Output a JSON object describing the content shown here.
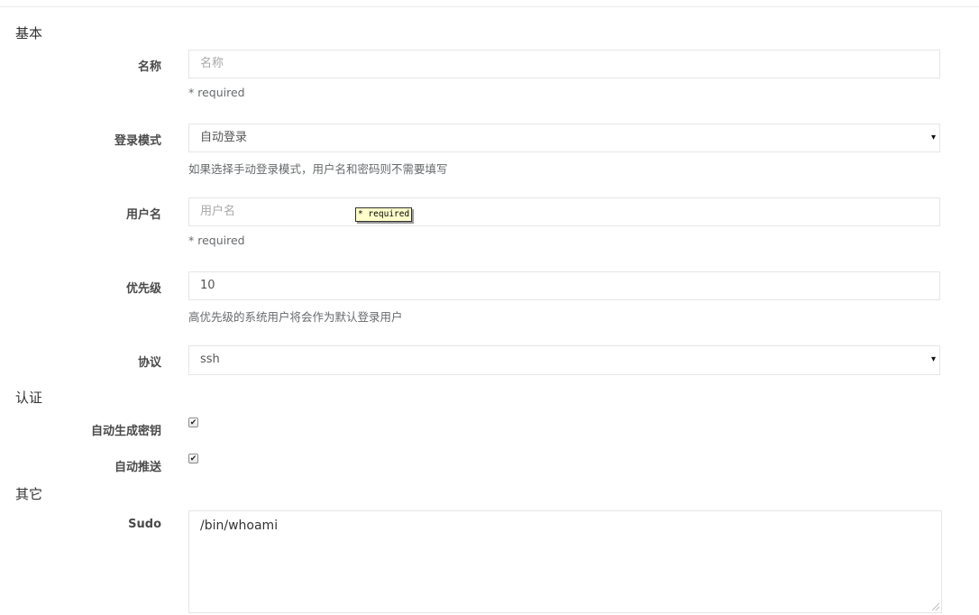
{
  "sections": {
    "basic": "基本",
    "auth": "认证",
    "other": "其它"
  },
  "fields": {
    "name": {
      "label": "名称",
      "placeholder": "名称",
      "help": "* required"
    },
    "login_mode": {
      "label": "登录模式",
      "value": "自动登录",
      "help": "如果选择手动登录模式，用户名和密码则不需要填写"
    },
    "username": {
      "label": "用户名",
      "placeholder": "用户名",
      "help": "* required",
      "tooltip": "* required"
    },
    "priority": {
      "label": "优先级",
      "value": "10",
      "help": "高优先级的系统用户将会作为默认登录用户"
    },
    "protocol": {
      "label": "协议",
      "value": "ssh"
    },
    "auto_generate_key": {
      "label": "自动生成密钥",
      "checked": true
    },
    "auto_push": {
      "label": "自动推送",
      "checked": true
    },
    "sudo": {
      "label": "Sudo",
      "value": "/bin/whoami"
    }
  },
  "icons": {
    "select_arrow": "▾",
    "checkmark": "✔"
  }
}
